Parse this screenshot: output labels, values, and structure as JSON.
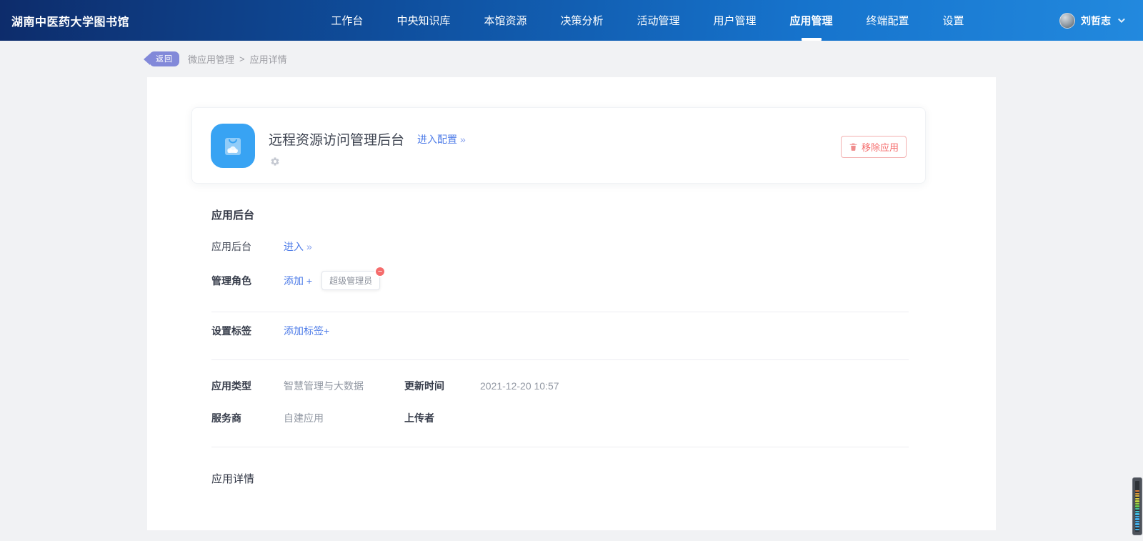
{
  "navbar": {
    "logo": "湖南中医药大学图书馆",
    "items": [
      {
        "label": "工作台"
      },
      {
        "label": "中央知识库"
      },
      {
        "label": "本馆资源"
      },
      {
        "label": "决策分析"
      },
      {
        "label": "活动管理"
      },
      {
        "label": "用户管理"
      },
      {
        "label": "应用管理",
        "active": true
      },
      {
        "label": "终端配置"
      },
      {
        "label": "设置"
      }
    ],
    "user": {
      "name": "刘哲志",
      "caret_icon": "chevron-down-icon",
      "avatar_icon": "user-avatar"
    }
  },
  "breadcrumb": {
    "back_label": "返回",
    "parent": "微应用管理",
    "separator": ">",
    "current": "应用详情"
  },
  "app_card": {
    "icon": "app-bag-icon",
    "title": "远程资源访问管理后台",
    "config_link": "进入配置",
    "gear_icon": "gear-icon",
    "remove_button": "移除应用",
    "trash_icon": "trash-icon"
  },
  "backend_section": {
    "heading": "应用后台",
    "backend_label": "应用后台",
    "backend_link": "进入",
    "roles_label": "管理角色",
    "roles_add_link": "添加 +",
    "role_tags": [
      {
        "label": "超级管理员",
        "removable": true
      }
    ]
  },
  "tags_section": {
    "label": "设置标签",
    "add_link": "添加标签+"
  },
  "info_section": {
    "fields": [
      {
        "label": "应用类型",
        "value": "智慧管理与大数据"
      },
      {
        "label": "更新时间",
        "value": "2021-12-20 10:57"
      },
      {
        "label": "服务商",
        "value": "自建应用"
      },
      {
        "label": "上传者",
        "value": ""
      }
    ]
  },
  "detail_section": {
    "heading": "应用详情"
  },
  "icons": {
    "minus": "−",
    "double_chevron": "»"
  },
  "colors": {
    "navbar_gradient_start": "#0d2c6b",
    "navbar_gradient_end": "#2289de",
    "accent_link": "#4e7ce8",
    "danger": "#f56c6c",
    "back_button": "#8289d9",
    "app_icon_blue": "#38a3f3",
    "page_background": "#f1f2f4",
    "panel_background": "#ffffff"
  },
  "activity_meter": {
    "stripes": [
      "#d97b36",
      "#dd9a3a",
      "#ddb83e",
      "#dccf3f",
      "#c2d641",
      "#9ed246",
      "#6cc94a",
      "#45c3a0",
      "#3fc4cf",
      "#41b9e0",
      "#42b0e6",
      "#43ace8",
      "#43ace8",
      "#44aee6",
      "#44aee6",
      "#45b0e4"
    ]
  }
}
